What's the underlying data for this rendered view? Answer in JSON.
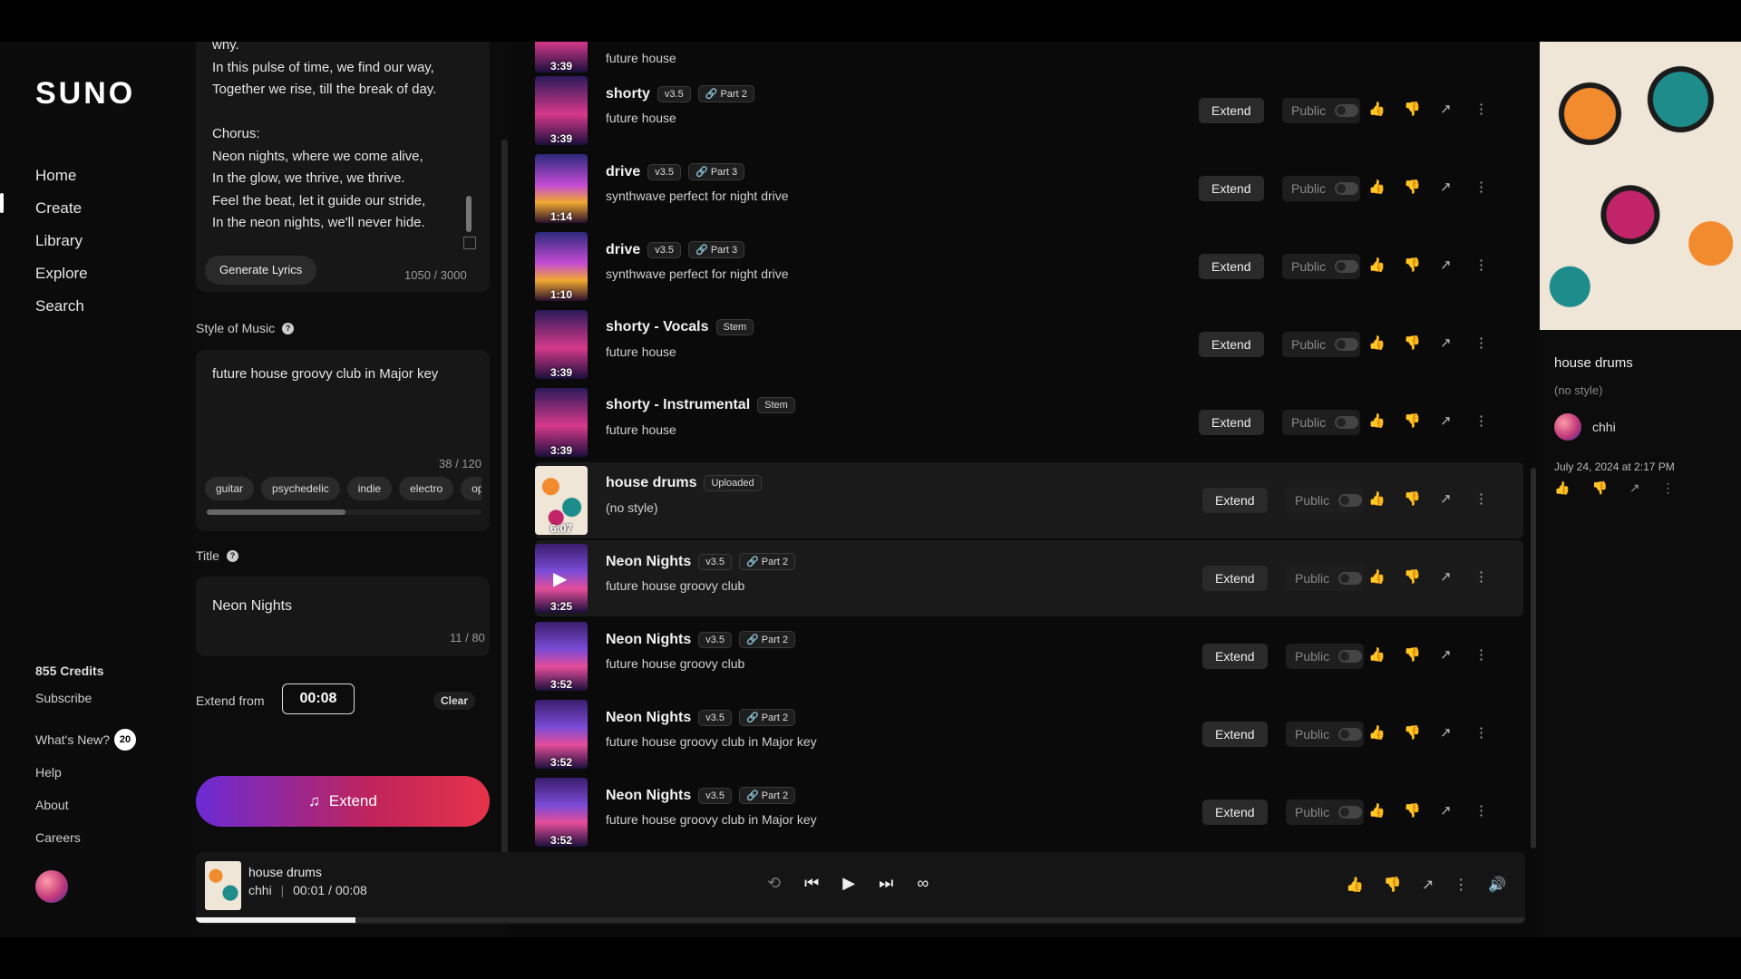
{
  "nav": {
    "logo": "SUNO",
    "items": [
      "Home",
      "Create",
      "Library",
      "Explore",
      "Search"
    ],
    "credits": "855 Credits",
    "subscribe": "Subscribe",
    "whats_new": "What's New?",
    "whats_new_count": "20",
    "help": "Help",
    "about": "About",
    "careers": "Careers"
  },
  "create": {
    "lyrics": "why.\nIn this pulse of time, we find our way,\nTogether we rise, till the break of day.\n\nChorus:\nNeon nights, where we come alive,\nIn the glow, we thrive, we thrive.\nFeel the beat, let it guide our stride,\nIn the neon nights, we'll never hide.",
    "generate_lyrics": "Generate Lyrics",
    "lyrics_count": "1050 / 3000",
    "style_label": "Style of Music",
    "style_value": "future house groovy club in Major key",
    "style_count": "38 / 120",
    "tags": [
      "guitar",
      "psychedelic",
      "indie",
      "electro",
      "op"
    ],
    "title_label": "Title",
    "title_value": "Neon Nights",
    "title_count": "11 / 80",
    "extend_from_label": "Extend from",
    "extend_from_value": "00:08",
    "clear": "Clear",
    "extend_button": "Extend"
  },
  "songs": [
    {
      "title": "",
      "version": "",
      "tag": "",
      "sub": "future house",
      "dur": "3:39"
    },
    {
      "title": "shorty",
      "version": "v3.5",
      "tag": "Part 2",
      "sub": "future house",
      "dur": "3:39"
    },
    {
      "title": "drive",
      "version": "v3.5",
      "tag": "Part 3",
      "sub": "synthwave perfect for night drive",
      "dur": "1:14"
    },
    {
      "title": "drive",
      "version": "v3.5",
      "tag": "Part 3",
      "sub": "synthwave perfect for night drive",
      "dur": "1:10"
    },
    {
      "title": "shorty - Vocals",
      "version": "",
      "tag": "Stem",
      "sub": "future house",
      "dur": "3:39"
    },
    {
      "title": "shorty - Instrumental",
      "version": "",
      "tag": "Stem",
      "sub": "future house",
      "dur": "3:39"
    },
    {
      "title": "house drums",
      "version": "",
      "tag": "Uploaded",
      "sub": "(no style)",
      "dur": "6:07"
    },
    {
      "title": "Neon Nights",
      "version": "v3.5",
      "tag": "Part 2",
      "sub": "future house groovy club",
      "dur": "3:25"
    },
    {
      "title": "Neon Nights",
      "version": "v3.5",
      "tag": "Part 2",
      "sub": "future house groovy club",
      "dur": "3:52"
    },
    {
      "title": "Neon Nights",
      "version": "v3.5",
      "tag": "Part 2",
      "sub": "future house groovy club in Major key",
      "dur": "3:52"
    },
    {
      "title": "Neon Nights",
      "version": "v3.5",
      "tag": "Part 2",
      "sub": "future house groovy club in Major key",
      "dur": "3:52"
    }
  ],
  "row_labels": {
    "extend": "Extend",
    "public": "Public"
  },
  "detail": {
    "title": "house drums",
    "style": "(no style)",
    "user": "chhi",
    "date": "July 24, 2024 at 2:17 PM"
  },
  "player": {
    "title": "house drums",
    "user": "chhi",
    "time": "00:01 / 00:08",
    "progress": 0.12
  }
}
